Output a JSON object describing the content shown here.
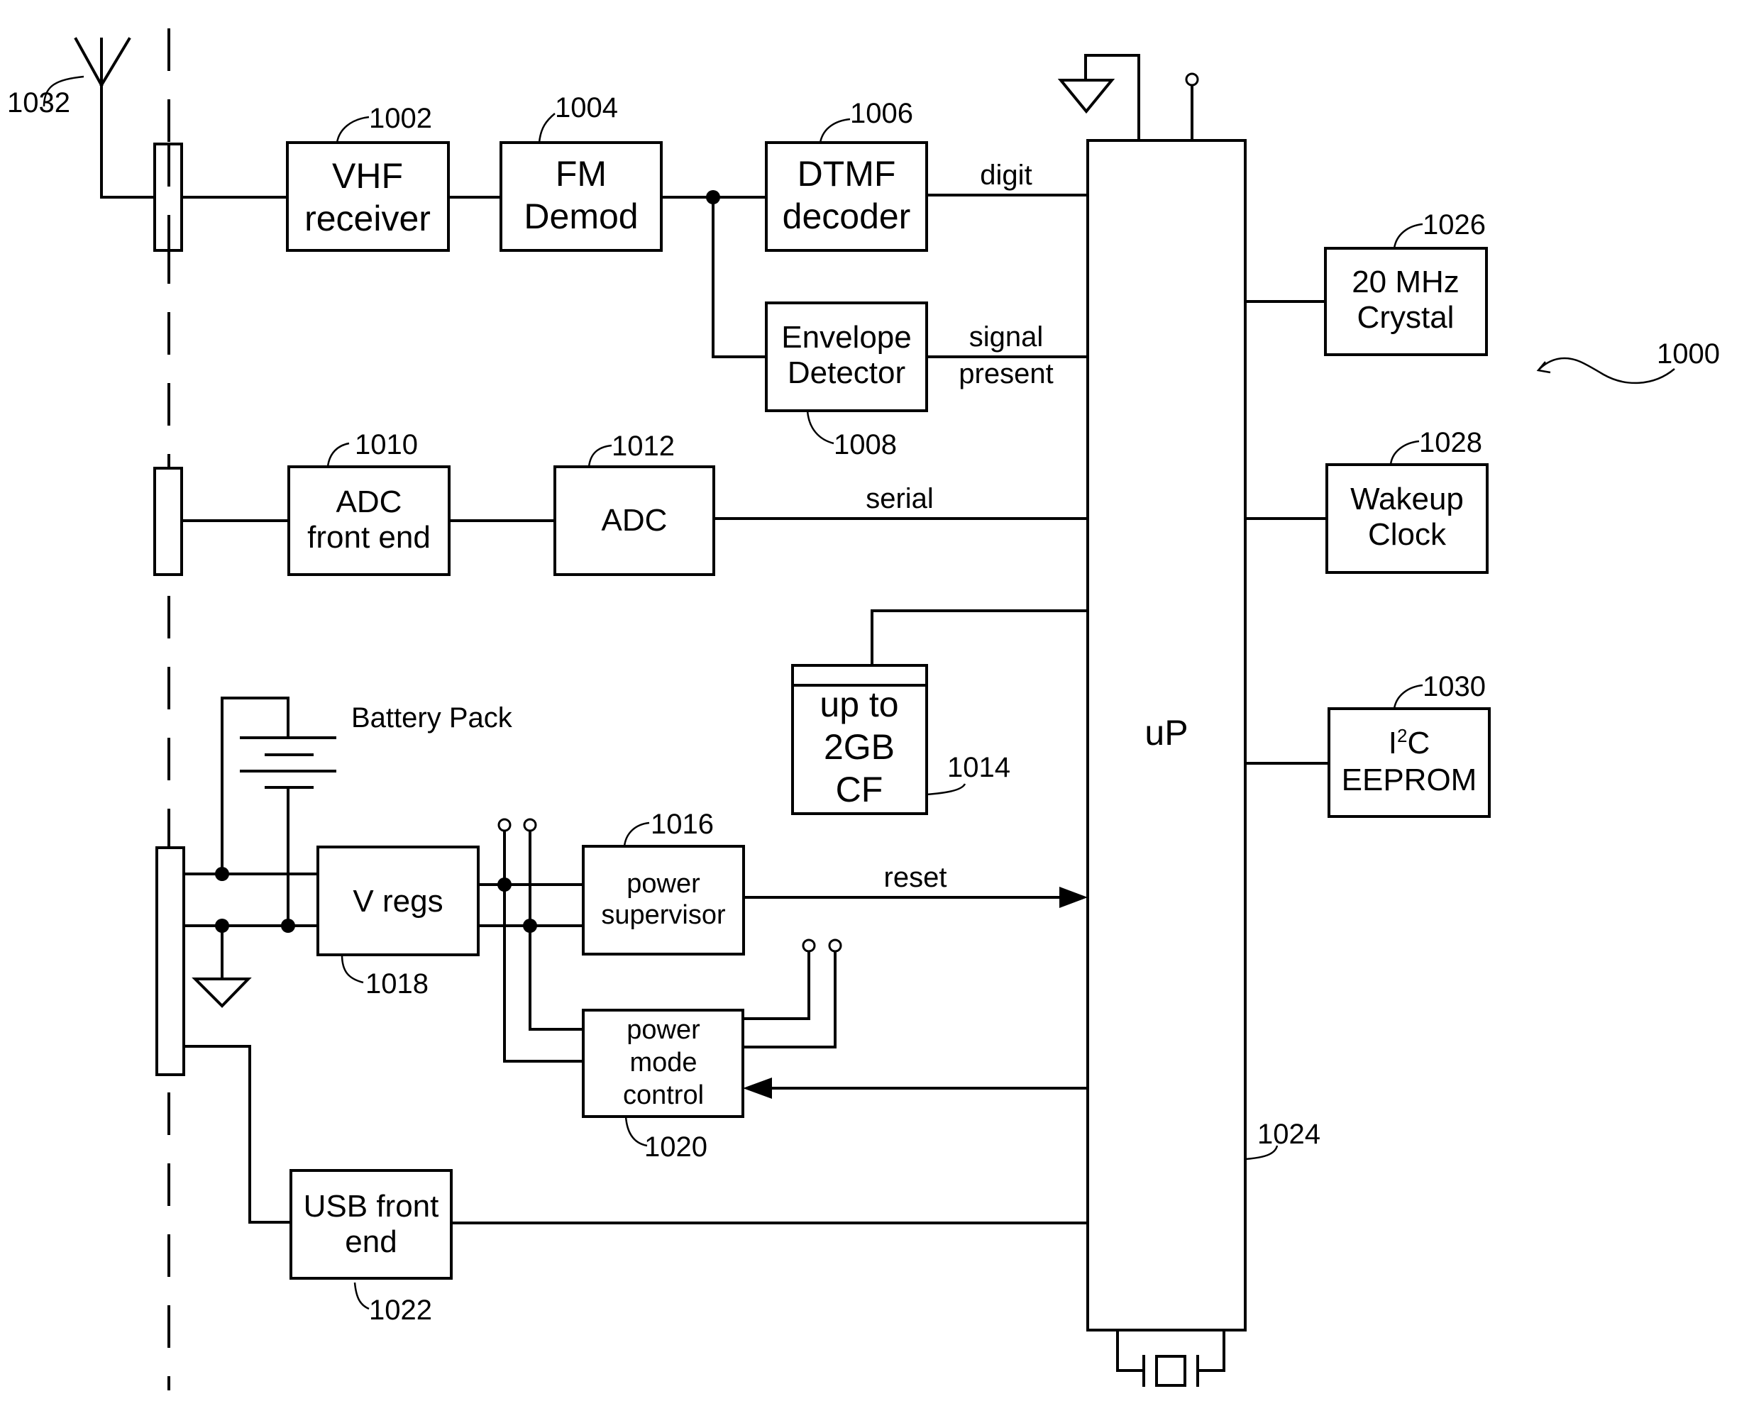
{
  "figure": {
    "reference": "1000",
    "title": "Block diagram of device 1000"
  },
  "blocks": {
    "vhf_receiver": {
      "lines": [
        "VHF",
        "receiver"
      ],
      "ref": "1002"
    },
    "fm_demod": {
      "lines": [
        "FM",
        "Demod"
      ],
      "ref": "1004"
    },
    "dtmf_decoder": {
      "lines": [
        "DTMF",
        "decoder"
      ],
      "ref": "1006"
    },
    "envelope_detector": {
      "lines": [
        "Envelope",
        "Detector"
      ],
      "ref": "1008"
    },
    "adc_front_end": {
      "lines": [
        "ADC",
        "front end"
      ],
      "ref": "1010"
    },
    "adc": {
      "lines": [
        "ADC"
      ],
      "ref": "1012"
    },
    "cf_card": {
      "lines": [
        "up to",
        "2GB",
        "CF"
      ],
      "ref": "1014"
    },
    "power_supervisor": {
      "lines": [
        "power",
        "supervisor"
      ],
      "ref": "1016"
    },
    "v_regs": {
      "lines": [
        "V regs"
      ],
      "ref": "1018"
    },
    "power_mode_control": {
      "lines": [
        "power",
        "mode",
        "control"
      ],
      "ref": "1020"
    },
    "usb_front_end": {
      "lines": [
        "USB front",
        "end"
      ],
      "ref": "1022"
    },
    "microprocessor": {
      "lines": [
        "uP"
      ],
      "ref": "1024"
    },
    "crystal": {
      "lines": [
        "20 MHz",
        "Crystal"
      ],
      "ref": "1026"
    },
    "wakeup_clock": {
      "lines": [
        "Wakeup",
        "Clock"
      ],
      "ref": "1028"
    },
    "eeprom": {
      "line1_main": "I",
      "line1_sup": "2",
      "line1_tail": "C",
      "line2": "EEPROM",
      "ref": "1030"
    },
    "antenna": {
      "ref": "1032"
    },
    "battery_pack": {
      "label": "Battery Pack"
    }
  },
  "signals": {
    "digit": "digit",
    "signal_present": [
      "signal",
      "present"
    ],
    "serial": "serial",
    "reset": "reset"
  }
}
